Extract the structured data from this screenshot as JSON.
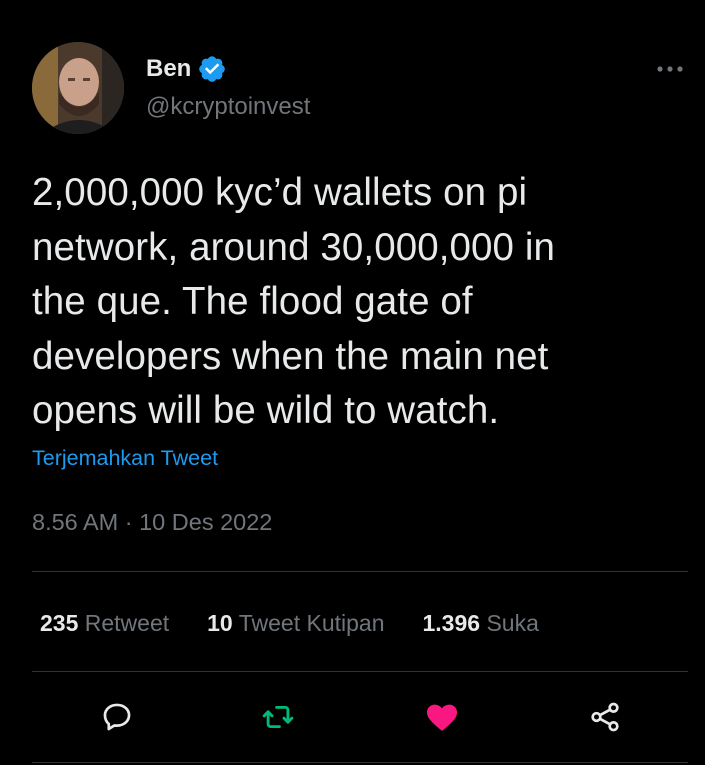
{
  "author": {
    "display_name": "Ben",
    "handle": "@kcryptoinvest",
    "verified": true
  },
  "tweet": {
    "text": "2,000,000 kyc’d wallets on pi\nnetwork, around 30,000,000 in\nthe que. The flood gate of\ndevelopers when the main net\nopens will be wild to watch.",
    "translate_label": "Terjemahkan Tweet",
    "timestamp": "8.56 AM · 10 Des 2022"
  },
  "stats": {
    "retweets": {
      "count": "235",
      "label": "Retweet"
    },
    "quotes": {
      "count": "10",
      "label": "Tweet Kutipan"
    },
    "likes": {
      "count": "1.396",
      "label": "Suka"
    }
  },
  "actions": [
    {
      "icon": "reply-icon"
    },
    {
      "icon": "retweet-icon",
      "color": "#00ba7c"
    },
    {
      "icon": "heart-icon",
      "color": "#f91880"
    },
    {
      "icon": "share-icon"
    }
  ],
  "colors": {
    "background": "#000000",
    "text": "#e7e9ea",
    "muted": "#71767b",
    "link": "#1d9bf0",
    "retweet": "#00ba7c",
    "like": "#f91880",
    "verified": "#1d9bf0"
  }
}
